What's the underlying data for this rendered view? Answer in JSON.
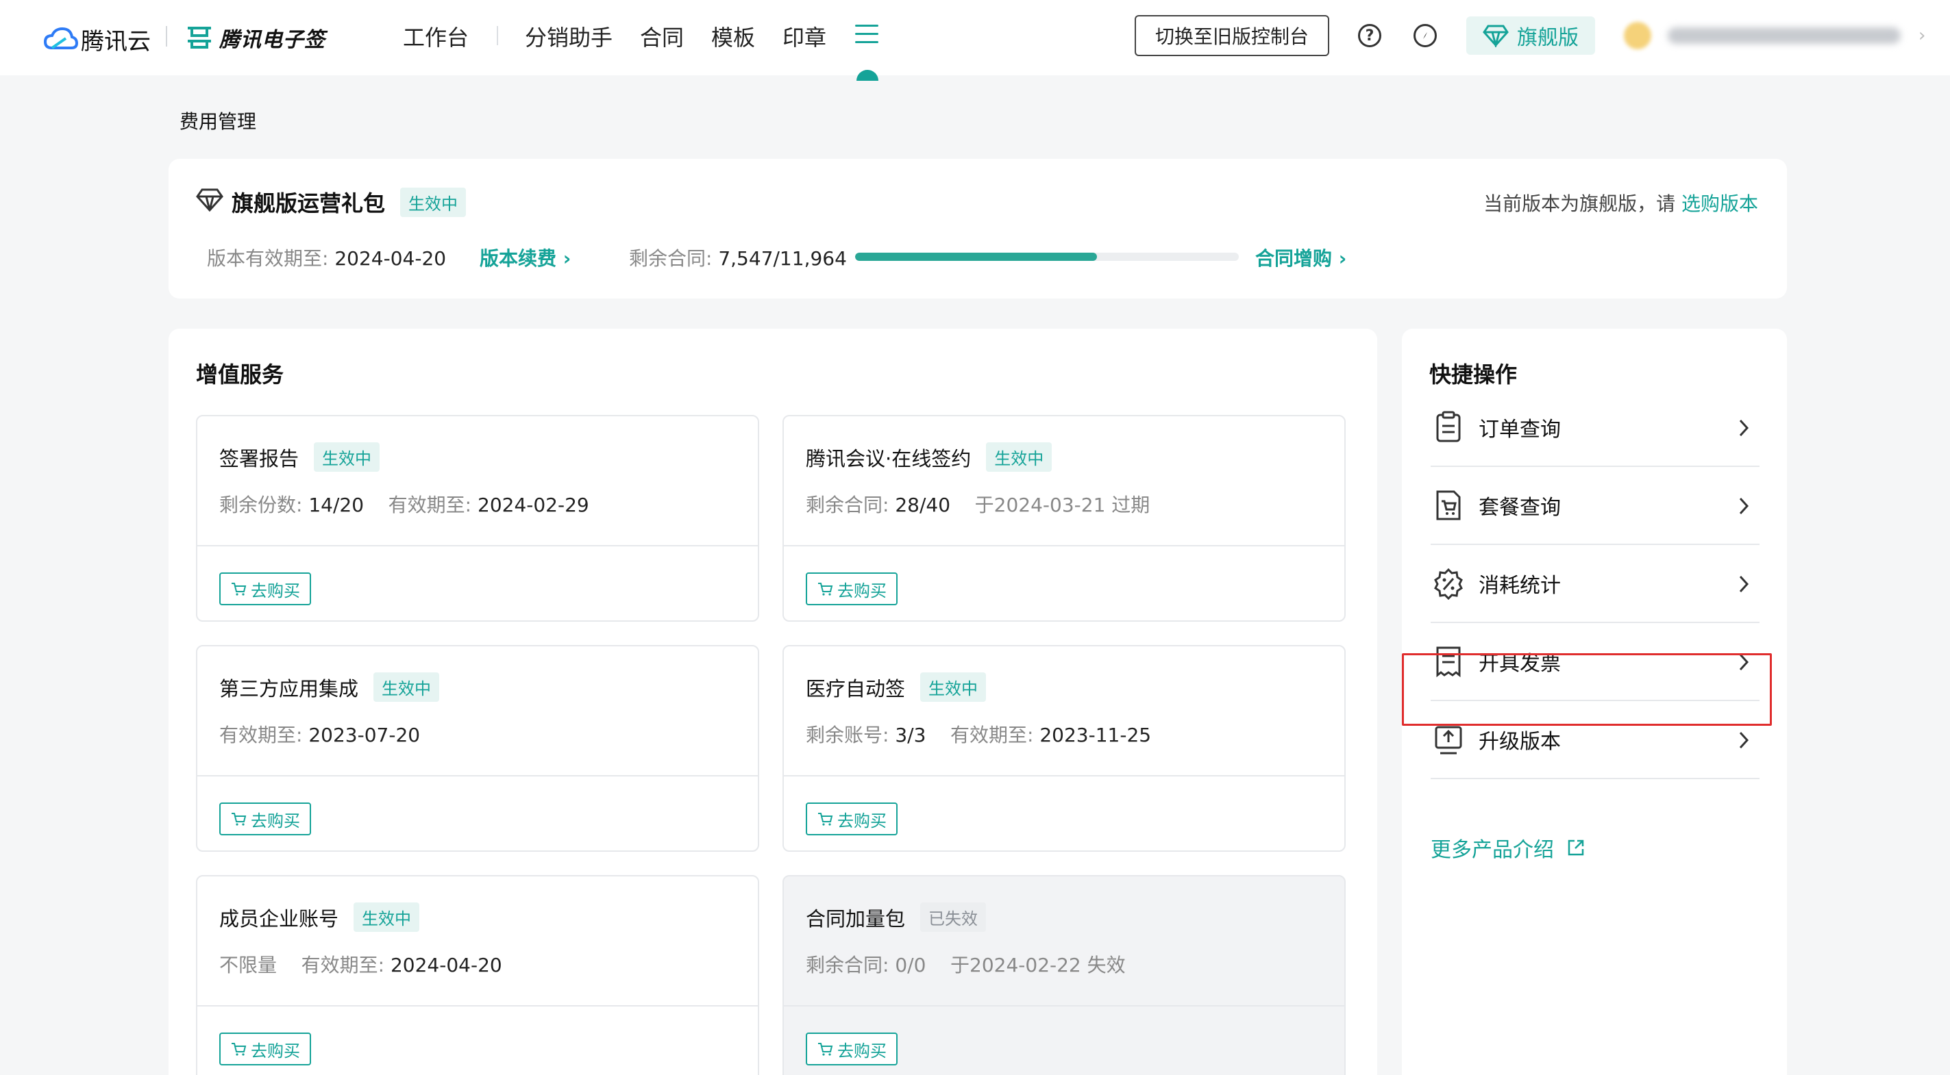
{
  "header": {
    "brand": "腾讯云",
    "product": "腾讯电子签",
    "nav": [
      "工作台",
      "分销助手",
      "合同",
      "模板",
      "印章"
    ],
    "switch_label": "切换至旧版控制台",
    "help_icon": "help-circle-icon",
    "explore_icon": "compass-icon",
    "edition_badge": "旗舰版",
    "colors": {
      "accent": "#15a398"
    }
  },
  "page_title": "费用管理",
  "package": {
    "name": "旗舰版运营礼包",
    "status": "生效中",
    "expiry_label": "版本有效期至:",
    "expiry_value": "2024-04-20",
    "renew_link": "版本续费 ›",
    "remain_label": "剩余合同:",
    "remain_value": "7,547/11,964",
    "progress_fraction": 0.63,
    "buy_more_link": "合同增购 ›",
    "current_version_text": "当前版本为旗舰版，请",
    "select_version_link": "选购版本"
  },
  "services": {
    "title": "增值服务",
    "items": [
      {
        "name": "签署报告",
        "status": "生效中",
        "info_label_1": "剩余份数:",
        "info_value_1": "14/20",
        "info_label_2": "有效期至:",
        "info_value_2": "2024-02-29",
        "buy": "去购买"
      },
      {
        "name": "腾讯会议·在线签约",
        "status": "生效中",
        "info_label_1": "剩余合同:",
        "info_value_1": "28/40",
        "info_label_2": "于2024-03-21 过期",
        "info_value_2": "",
        "buy": "去购买"
      },
      {
        "name": "第三方应用集成",
        "status": "生效中",
        "info_label_1": "有效期至:",
        "info_value_1": "2023-07-20",
        "info_label_2": "",
        "info_value_2": "",
        "buy": "去购买"
      },
      {
        "name": "医疗自动签",
        "status": "生效中",
        "info_label_1": "剩余账号:",
        "info_value_1": "3/3",
        "info_label_2": "有效期至:",
        "info_value_2": "2023-11-25",
        "buy": "去购买"
      },
      {
        "name": "成员企业账号",
        "status": "生效中",
        "info_label_1": "不限量",
        "info_value_1": "",
        "info_label_2": "有效期至:",
        "info_value_2": "2024-04-20",
        "buy": "去购买"
      },
      {
        "name": "合同加量包",
        "status": "已失效",
        "info_label_1": "剩余合同:",
        "info_value_1": "0/0",
        "info_label_2": "于2024-02-22 失效",
        "info_value_2": "",
        "buy": "去购买"
      }
    ]
  },
  "quick_actions": {
    "title": "快捷操作",
    "items": [
      {
        "label": "订单查询",
        "icon": "clipboard-list-icon"
      },
      {
        "label": "套餐查询",
        "icon": "package-cart-icon"
      },
      {
        "label": "消耗统计",
        "icon": "percent-badge-icon"
      },
      {
        "label": "开具发票",
        "icon": "invoice-icon"
      },
      {
        "label": "升级版本",
        "icon": "upgrade-icon"
      }
    ],
    "more_link": "更多产品介绍"
  }
}
